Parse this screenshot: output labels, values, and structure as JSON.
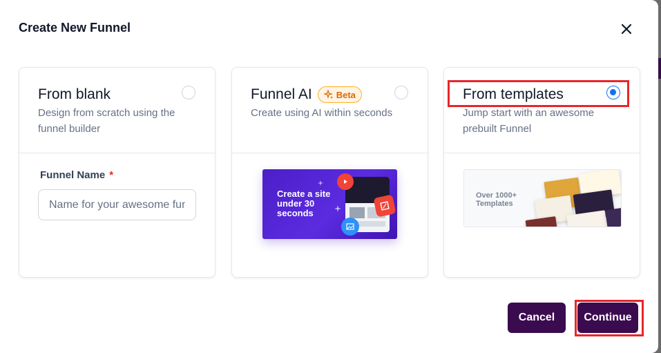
{
  "modal": {
    "title": "Create New Funnel"
  },
  "options": {
    "blank": {
      "title": "From blank",
      "description": "Design from scratch using the funnel builder",
      "field_label": "Funnel Name",
      "required_mark": "*",
      "input_placeholder": "Name for your awesome funnel",
      "input_value": ""
    },
    "ai": {
      "title": "Funnel AI",
      "badge": "Beta",
      "description": "Create using AI within seconds",
      "banner_text": "Create a site under 30 seconds"
    },
    "templates": {
      "title": "From templates",
      "description": "Jump start with an awesome prebuilt Funnel",
      "banner_text": "Over 1000+ Templates",
      "selected": true
    }
  },
  "buttons": {
    "cancel": "Cancel",
    "continue": "Continue"
  },
  "colors": {
    "primary": "#3b0b4f",
    "radio_selected": "#1570ef",
    "highlight": "#e8252a",
    "beta": "#dc6803",
    "required": "#d92d20"
  }
}
